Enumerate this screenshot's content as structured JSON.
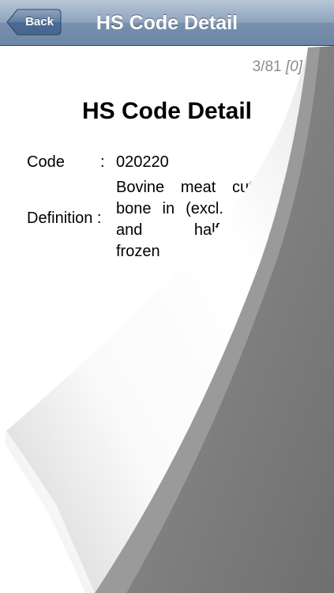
{
  "navbar": {
    "back_label": "Back",
    "title": "HS Code Detail"
  },
  "page_counter": {
    "current_total": "3/81",
    "bracket_value": "[0]"
  },
  "content": {
    "title": "HS Code Detail",
    "code_label": "Code",
    "code_colon": ":",
    "code_value": "020220",
    "definition_label": "Definition :",
    "definition_value": "Bovine meat cuts with bone in (excl. carcasses and half-carcasses), frozen"
  },
  "colors": {
    "navbar": "#7890ad",
    "page_background": "#ffffff",
    "counter_text": "#8c8c8c"
  }
}
